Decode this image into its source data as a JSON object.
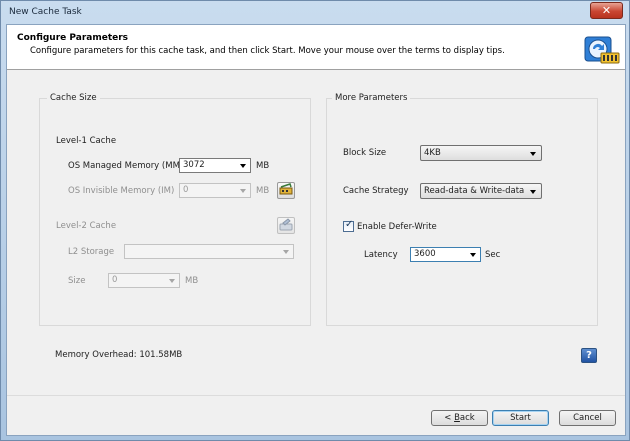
{
  "window": {
    "title": "New Cache Task",
    "close_glyph": "✕"
  },
  "header": {
    "title": "Configure Parameters",
    "subtitle": "Configure parameters for this cache task, and then click Start. Move your mouse over the terms to display tips.",
    "icon": "cache-task-icon"
  },
  "cache_size": {
    "legend": "Cache Size",
    "level1": {
      "heading": "Level-1 Cache",
      "os_managed_label": "OS Managed Memory (MM)",
      "os_managed_value": "3072",
      "os_managed_unit": "MB",
      "os_invisible_label": "OS Invisible Memory (IM)",
      "os_invisible_value": "0",
      "os_invisible_unit": "MB"
    },
    "level2": {
      "heading": "Level-2 Cache",
      "storage_label": "L2 Storage",
      "storage_value": "",
      "size_label": "Size",
      "size_value": "0",
      "size_unit": "MB"
    }
  },
  "more_params": {
    "legend": "More Parameters",
    "block_size_label": "Block Size",
    "block_size_value": "4KB",
    "strategy_label": "Cache Strategy",
    "strategy_value": "Read-data & Write-data",
    "defer_write_label": "Enable Defer-Write",
    "defer_write_checked": true,
    "latency_label": "Latency",
    "latency_value": "3600",
    "latency_unit": "Sec"
  },
  "footer": {
    "memory_overhead": "Memory Overhead: 101.58MB",
    "help_glyph": "?",
    "back_prefix": "< ",
    "back_accel": "B",
    "back_rest": "ack",
    "start_label": "Start",
    "cancel_label": "Cancel"
  }
}
